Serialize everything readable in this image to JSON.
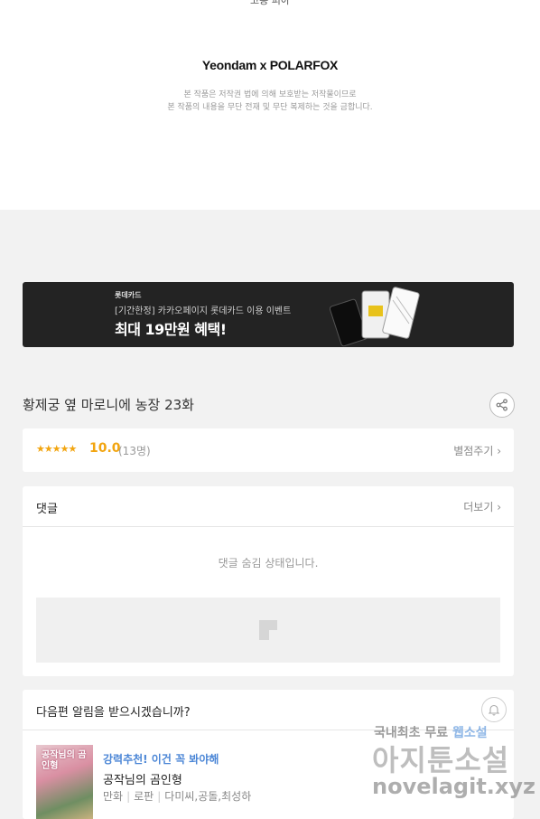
{
  "footer": {
    "cut_text": "고용 피아",
    "studio_logo": "Yeondam x POLARFOX",
    "copyright_line1": "본 작품은 저작권 법에 의해 보호받는 저작물이므로",
    "copyright_line2": "본 작품의 내용을 무단 전재 및 무단 복제하는 것을 금합니다."
  },
  "banner": {
    "brand": "롯데카드",
    "subtitle": "[기간한정] 카카오페이지 롯데카드 이용 이벤트",
    "headline": "최대 19만원 혜택!"
  },
  "episode": {
    "title": "황제궁 옆 마로니에 농장 23화",
    "share_icon": "share-icon"
  },
  "rating": {
    "stars": "★★★★★",
    "score": "10.0",
    "count": "(13명)",
    "rate_link": "별점주기 ›"
  },
  "comments": {
    "title": "댓글",
    "more_link": "더보기 ›",
    "hidden_message": "댓글 숨김 상태입니다."
  },
  "notify": {
    "question": "다음편 알림을 받으시겠습니까?",
    "bell_icon": "bell-icon"
  },
  "recommendation": {
    "label": "강력추천! 이건 꼭 봐야해",
    "title": "공작님의 곰인형",
    "thumb_text": "공작님의 곰인형",
    "genre": "만화",
    "subgenre": "로판",
    "authors": "다미씨,공돌,최성하"
  },
  "watermark": {
    "line1_a": "국내최초 무료",
    "line1_b": "웹소설",
    "line2": "아지툰소설",
    "line3": "novelagit.xyz"
  }
}
